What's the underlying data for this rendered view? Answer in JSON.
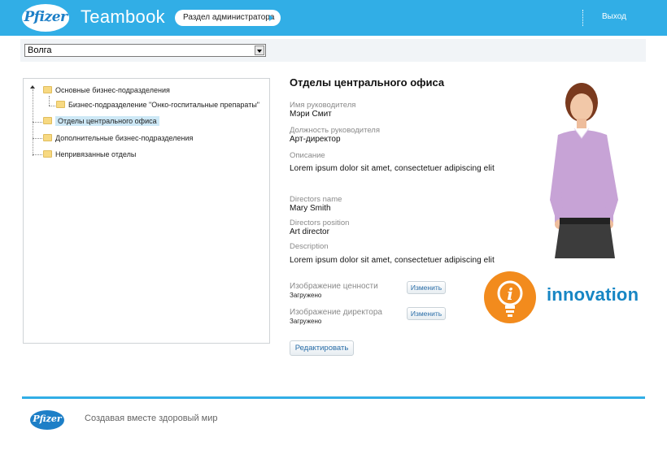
{
  "header": {
    "logo_text": "Pfizer",
    "app_name": "Teambook",
    "admin_section": "Раздел администратора",
    "logout": "Выход"
  },
  "region_select": {
    "selected": "Волга"
  },
  "tree": {
    "items": [
      {
        "label": "Основные бизнес-подразделения"
      },
      {
        "label": "Бизнес-подразделение \"Онко-госпитальные препараты\""
      },
      {
        "label": "Отделы центрального офиса"
      },
      {
        "label": "Дополнительные бизнес-подразделения"
      },
      {
        "label": "Непривязанные отделы"
      }
    ]
  },
  "details": {
    "title": "Отделы центрального офиса",
    "ru": {
      "director_name_label": "Имя руководителя",
      "director_name": "Мэри Смит",
      "director_position_label": "Должность руководителя",
      "director_position": "Арт-директор",
      "description_label": "Описание",
      "description": "Lorem ipsum dolor sit amet, consectetuer adipiscing elit"
    },
    "en": {
      "director_name_label": "Directors name",
      "director_name": "Mary Smith",
      "director_position_label": "Directors position",
      "director_position": "Art director",
      "description_label": "Description",
      "description": "Lorem ipsum dolor sit amet, consectetuer adipiscing elit"
    },
    "value_image_label": "Изображение ценности",
    "value_image_status": "Загружено",
    "director_image_label": "Изображение директора",
    "director_image_status": "Загружено",
    "change_label": "Изменить",
    "edit_label": "Редактировать",
    "innovation_text": "innovation"
  },
  "footer": {
    "logo_text": "Pfizer",
    "tagline": "Создавая вместе здоровый мир"
  },
  "colors": {
    "header_bg": "#31aee6",
    "brand_blue": "#1d7fc7",
    "innovation_orange": "#f28b1d"
  }
}
